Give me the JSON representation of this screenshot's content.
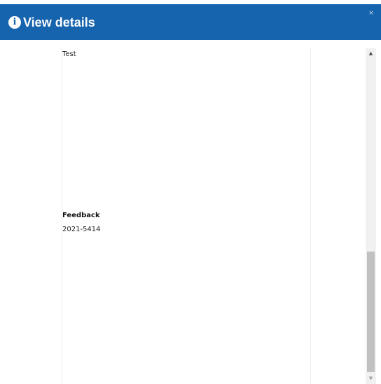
{
  "dialog": {
    "title": "View details",
    "title_icon": "info-icon",
    "title_icon_glyph": "i",
    "close_glyph": "×",
    "accent_color": "#1764ae"
  },
  "content": {
    "description_value": "Test",
    "feedback_label": "Feedback",
    "feedback_value": "2021-5414"
  },
  "scrollbar": {
    "up_glyph": "▲",
    "down_glyph": "▼",
    "position_fraction": 0.6
  }
}
